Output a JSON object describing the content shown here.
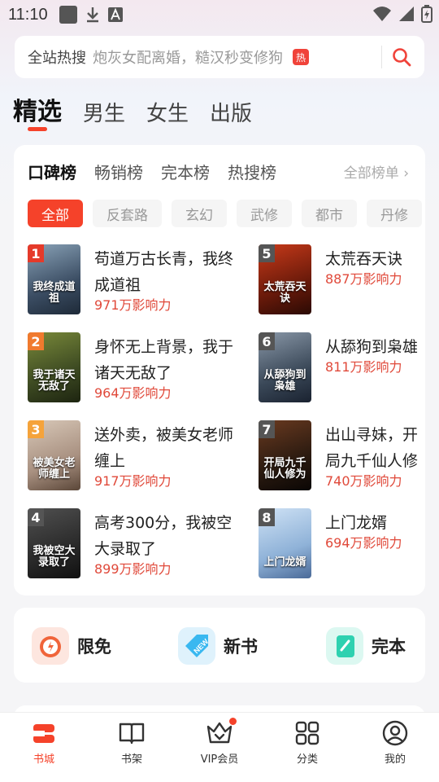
{
  "status": {
    "time": "11:10"
  },
  "search": {
    "label": "全站热搜",
    "placeholder": "炮灰女配离婚，糙汉秒变修狗",
    "hot_badge": "热",
    "icon": "search-icon"
  },
  "main_tabs": [
    "精选",
    "男生",
    "女生",
    "出版"
  ],
  "ranking": {
    "tabs": [
      "口碑榜",
      "畅销榜",
      "完本榜",
      "热搜榜"
    ],
    "all_lists": "全部榜单 ›",
    "chips": [
      "全部",
      "反套路",
      "玄幻",
      "武修",
      "都市",
      "丹修"
    ],
    "books": [
      {
        "rank": "1",
        "title": "苟道万古长青，我终成道祖",
        "influence": "971万影响力",
        "cover_text": "我终成道祖",
        "rank_color": "#e53a2a"
      },
      {
        "rank": "2",
        "title": "身怀无上背景，我于诸天无敌了",
        "influence": "964万影响力",
        "cover_text": "我于诸天无敌了",
        "rank_color": "#f07a2e"
      },
      {
        "rank": "3",
        "title": "送外卖，被美女老师缠上",
        "influence": "917万影响力",
        "cover_text": "被美女老师缠上",
        "rank_color": "#f5a33a"
      },
      {
        "rank": "4",
        "title": "高考300分，我被空大录取了",
        "influence": "899万影响力",
        "cover_text": "我被空大录取了",
        "rank_color": "#555555"
      },
      {
        "rank": "5",
        "title": "太荒吞天诀",
        "influence": "887万影响力",
        "cover_text": "太荒吞天诀",
        "rank_color": "#555555"
      },
      {
        "rank": "6",
        "title": "从舔狗到枭雄",
        "influence": "811万影响力",
        "cover_text": "从舔狗到枭雄",
        "rank_color": "#555555"
      },
      {
        "rank": "7",
        "title": "出山寻妹，开局九千仙人修为",
        "influence": "740万影响力",
        "cover_text": "开局九千仙人修为",
        "rank_color": "#555555"
      },
      {
        "rank": "8",
        "title": "上门龙婿",
        "influence": "694万影响力",
        "cover_text": "上门龙婿",
        "rank_color": "#555555"
      }
    ]
  },
  "features": [
    {
      "label": "限免",
      "icon": "timer-icon",
      "color": "#f0643a"
    },
    {
      "label": "新书",
      "icon": "new-tag-icon",
      "color": "#3ab8f0"
    },
    {
      "label": "完本",
      "icon": "book-complete-icon",
      "color": "#2ed1b0"
    }
  ],
  "bottom_nav": [
    {
      "label": "书城",
      "icon": "bookstore-icon"
    },
    {
      "label": "书架",
      "icon": "bookshelf-icon"
    },
    {
      "label": "VIP会员",
      "icon": "vip-crown-icon"
    },
    {
      "label": "分类",
      "icon": "category-grid-icon"
    },
    {
      "label": "我的",
      "icon": "profile-icon"
    }
  ]
}
